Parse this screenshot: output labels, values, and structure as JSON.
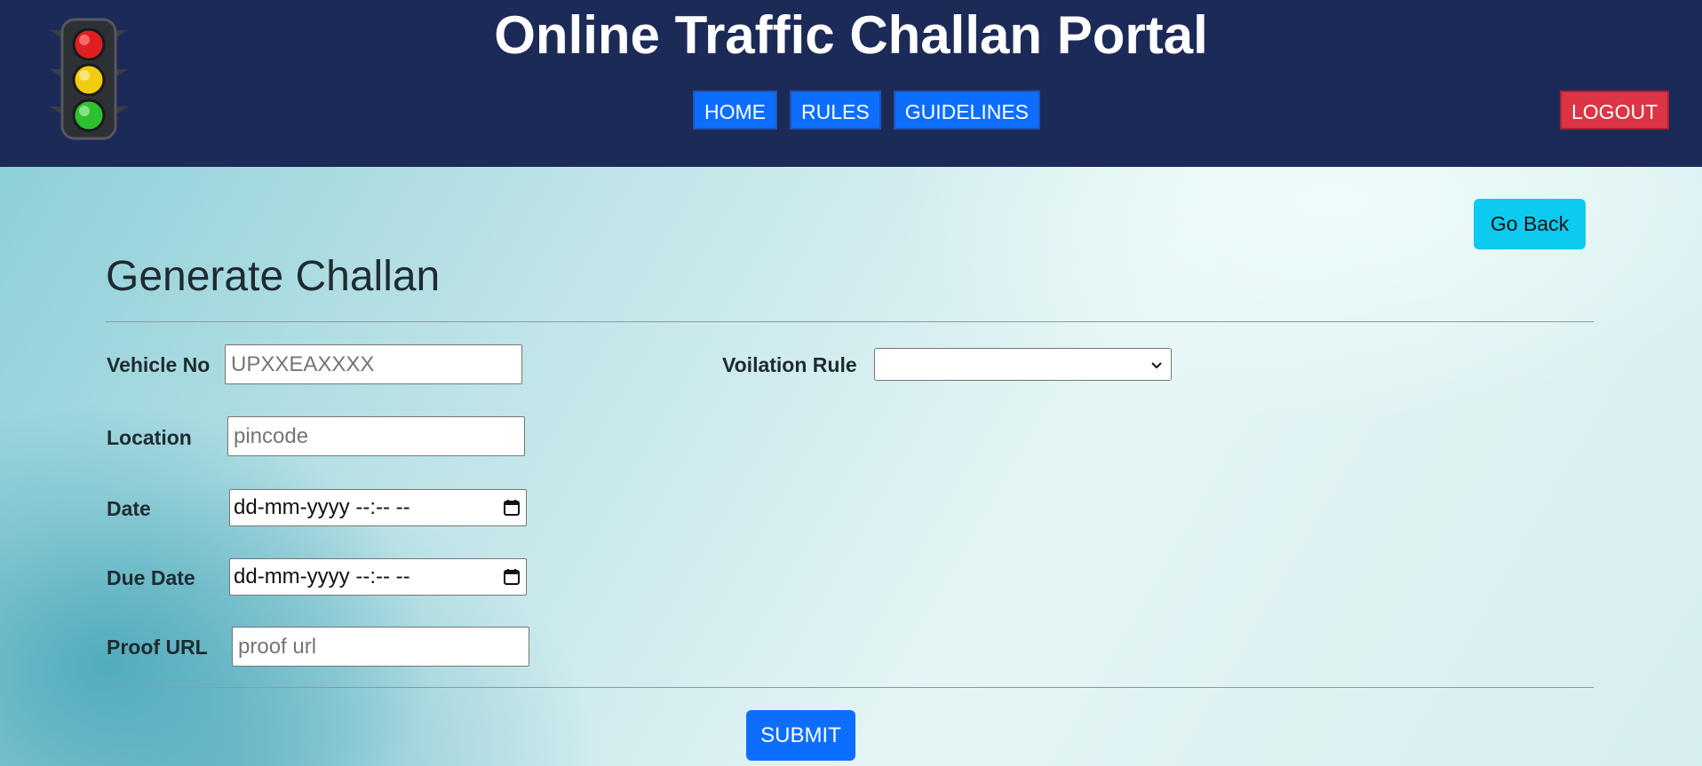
{
  "header": {
    "title": "Online Traffic Challan Portal",
    "logo_icon": "traffic-light-icon",
    "nav": [
      {
        "label": "HOME"
      },
      {
        "label": "RULES"
      },
      {
        "label": "GUIDELINES"
      }
    ],
    "logout_label": "LOGOUT"
  },
  "main": {
    "go_back_label": "Go Back",
    "page_title": "Generate Challan",
    "form": {
      "vehicle_no": {
        "label": "Vehicle No",
        "placeholder": "UPXXEAXXXX",
        "value": ""
      },
      "location": {
        "label": "Location",
        "placeholder": "pincode",
        "value": ""
      },
      "date": {
        "label": "Date",
        "value": "dd-mm-yyyy --:-- --"
      },
      "due_date": {
        "label": "Due Date",
        "value": "dd-mm-yyyy --:-- --"
      },
      "proof_url": {
        "label": "Proof URL",
        "placeholder": "proof url",
        "value": ""
      },
      "violation_rule": {
        "label": "Voilation Rule",
        "selected": ""
      }
    },
    "submit_label": "SUBMIT"
  },
  "colors": {
    "header_bg": "#1c2a58",
    "nav_button": "#0d6efd",
    "logout_button": "#dc3545",
    "go_back_button": "#0dcaf0",
    "submit_button": "#0d6efd"
  }
}
